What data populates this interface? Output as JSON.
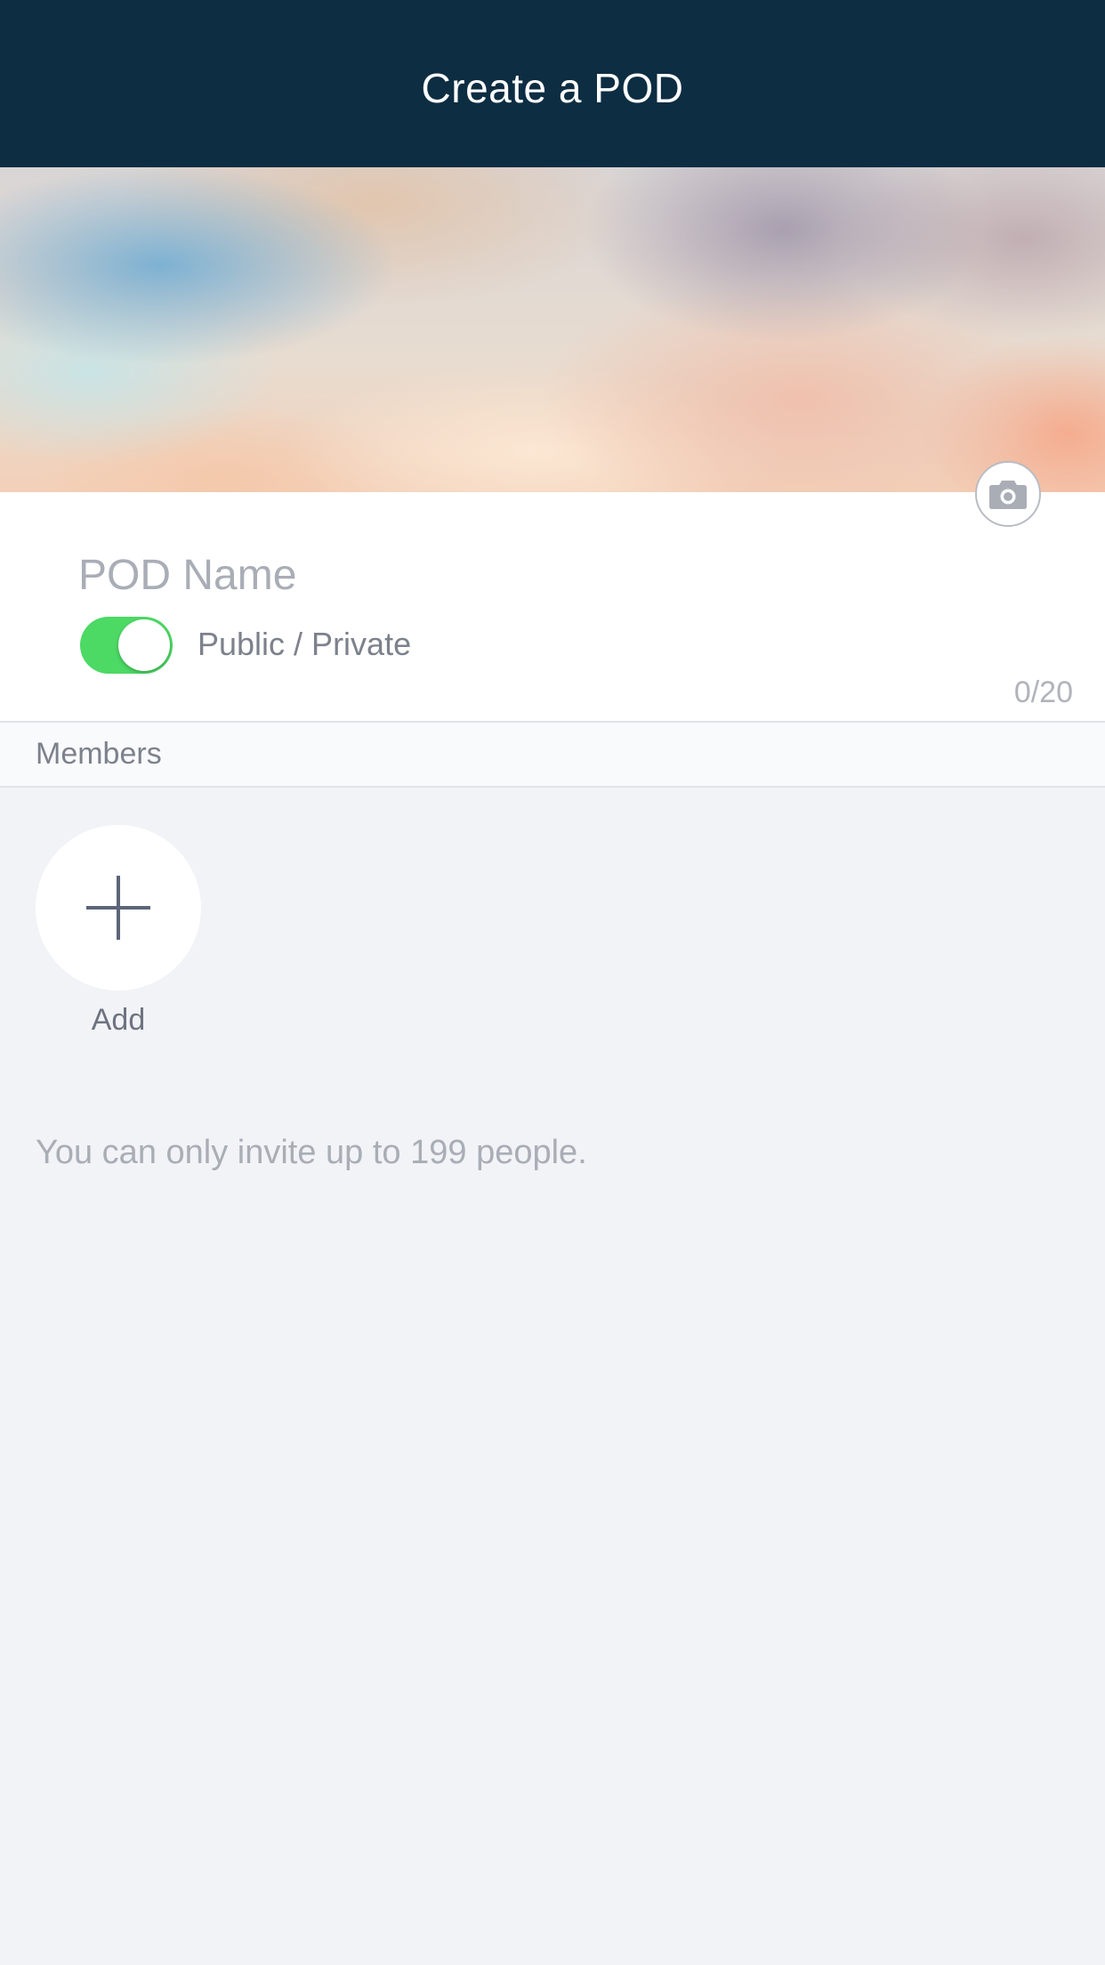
{
  "header": {
    "title": "Create a POD"
  },
  "cover": {
    "camera_icon": "camera-icon"
  },
  "pod_form": {
    "name_placeholder": "POD Name",
    "name_value": "",
    "visibility_label": "Public / Private",
    "visibility_toggle_on": true,
    "char_count": "0/20"
  },
  "members": {
    "section_label": "Members",
    "add_label": "Add",
    "add_icon": "plus-icon",
    "invite_limit_note": "You can only invite up to 199 people."
  },
  "colors": {
    "header_bg": "#0d2d42",
    "toggle_on": "#4cd964",
    "page_bg": "#f2f3f7"
  }
}
